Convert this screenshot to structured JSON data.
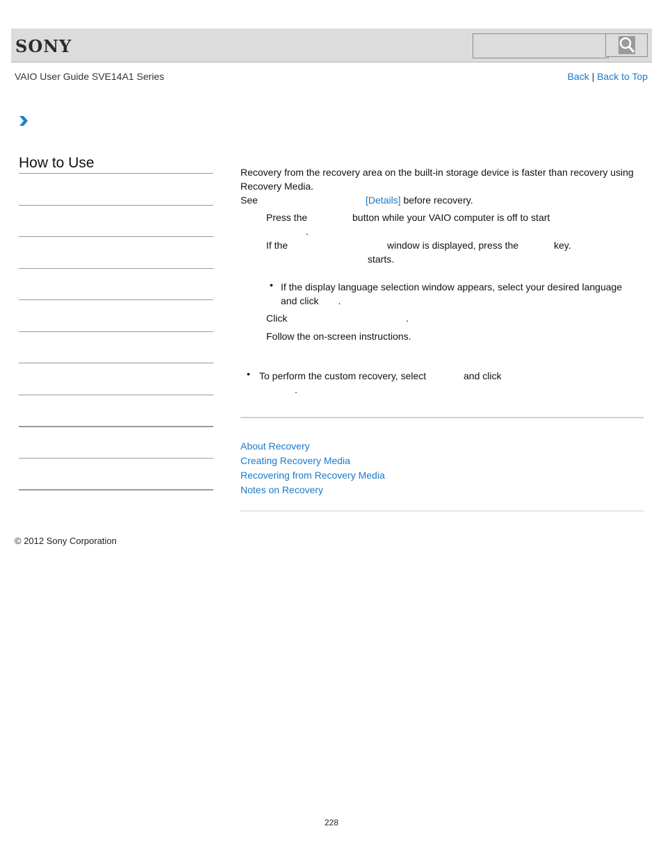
{
  "header": {
    "brand": "SONY",
    "search": {
      "placeholder": "",
      "value": ""
    },
    "search_icon": "magnifier-icon"
  },
  "nav": {
    "guide_title": "VAIO User Guide SVE14A1 Series",
    "back_label": "Back",
    "separator": "|",
    "back_to_top_label": "Back to Top"
  },
  "sidebar": {
    "breadcrumb_icon": "chevron-right-icon",
    "heading": "How to Use",
    "item_count": 10
  },
  "main": {
    "intro_line1": "Recovery from the recovery area on the built-in storage device is faster than recovery using",
    "intro_line2": "Recovery Media.",
    "see_prefix": "See",
    "details_link": "[Details]",
    "see_suffix": "before recovery.",
    "step1_a": "Press the",
    "step1_b": "button while your VAIO computer is off to start",
    "step1_c": ".",
    "step2_a": "If the",
    "step2_b": "window is displayed, press the",
    "step2_c": "key.",
    "step2_d": "starts.",
    "step2_note_line1": "If the display language selection window appears, select your desired language",
    "step2_note_line2_a": "and click",
    "step2_note_line2_b": ".",
    "step3_a": "Click",
    "step3_b": ".",
    "step4": "Follow the on-screen instructions.",
    "hint_line1_a": "To perform the custom recovery, select",
    "hint_line1_b": "and click",
    "hint_line2": ".",
    "related_links": [
      "About Recovery",
      "Creating Recovery Media",
      "Recovering from Recovery Media",
      "Notes on Recovery"
    ]
  },
  "footer": {
    "copyright": "© 2012 Sony Corporation",
    "page_number": "228"
  },
  "colors": {
    "link": "#1a78c8",
    "header_bg": "#dcdcdc",
    "accent_arrow": "#1a78c8"
  }
}
